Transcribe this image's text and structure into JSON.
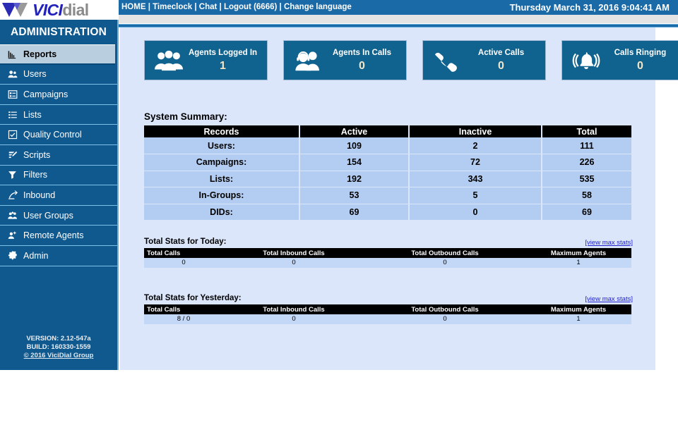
{
  "header": {
    "logo_vici": "VICI",
    "logo_dial": "dial",
    "nav": [
      {
        "label": "HOME"
      },
      {
        "label": "Timeclock"
      },
      {
        "label": "Chat"
      },
      {
        "label": "Logout (6666)"
      },
      {
        "label": "Change language"
      }
    ],
    "separator": " | ",
    "clock": "Thursday March 31, 2016 9:04:41 AM"
  },
  "sidebar": {
    "title": "ADMINISTRATION",
    "items": [
      {
        "label": "Reports",
        "icon": "bar-chart-icon",
        "active": true
      },
      {
        "label": "Users",
        "icon": "users-icon",
        "active": false
      },
      {
        "label": "Campaigns",
        "icon": "list-card-icon",
        "active": false
      },
      {
        "label": "Lists",
        "icon": "list-icon",
        "active": false
      },
      {
        "label": "Quality Control",
        "icon": "checkbox-icon",
        "active": false
      },
      {
        "label": "Scripts",
        "icon": "pencil-doc-icon",
        "active": false
      },
      {
        "label": "Filters",
        "icon": "funnel-icon",
        "active": false
      },
      {
        "label": "Inbound",
        "icon": "arrow-in-icon",
        "active": false
      },
      {
        "label": "User Groups",
        "icon": "user-group-icon",
        "active": false
      },
      {
        "label": "Remote Agents",
        "icon": "user-plus-icon",
        "active": false
      },
      {
        "label": "Admin",
        "icon": "gear-icon",
        "active": false
      }
    ],
    "version": "VERSION: 2.12-547a",
    "build": "BUILD: 160330-1559",
    "copyright": "© 2016 ViciDial Group"
  },
  "cards": [
    {
      "label": "Agents Logged In",
      "value": "1",
      "icon": "three-people-icon"
    },
    {
      "label": "Agents In Calls",
      "value": "0",
      "icon": "headset-agents-icon"
    },
    {
      "label": "Active Calls",
      "value": "0",
      "icon": "phone-handset-icon"
    },
    {
      "label": "Calls Ringing",
      "value": "0",
      "icon": "ringing-bell-icon"
    }
  ],
  "system_summary": {
    "title": "System Summary:",
    "columns": [
      "Records",
      "Active",
      "Inactive",
      "Total"
    ],
    "rows": [
      {
        "label": "Users:",
        "active": "109",
        "inactive": "2",
        "total": "111"
      },
      {
        "label": "Campaigns:",
        "active": "154",
        "inactive": "72",
        "total": "226"
      },
      {
        "label": "Lists:",
        "active": "192",
        "inactive": "343",
        "total": "535"
      },
      {
        "label": "In-Groups:",
        "active": "53",
        "inactive": "5",
        "total": "58"
      },
      {
        "label": "DIDs:",
        "active": "69",
        "inactive": "0",
        "total": "69"
      }
    ]
  },
  "today_stats": {
    "title": "Total Stats for Today:",
    "max_stats_link": "[view max stats]",
    "columns": [
      "Total Calls",
      "Total Inbound Calls",
      "Total Outbound Calls",
      "Maximum Agents"
    ],
    "values": [
      "0",
      "0",
      "0",
      "1"
    ]
  },
  "yesterday_stats": {
    "title": "Total Stats for Yesterday:",
    "max_stats_link": "[view max stats]",
    "columns": [
      "Total Calls",
      "Total Inbound Calls",
      "Total Outbound Calls",
      "Maximum Agents"
    ],
    "values": [
      "8 / 0",
      "0",
      "0",
      "1"
    ]
  },
  "colors": {
    "header_blue": "#1a6aa8",
    "sidebar_blue": "#10598f",
    "content_blue": "#dbe6fb",
    "card_blue": "#10628f",
    "table_row": "#b3cdf2",
    "link_purple": "#5b2d8e",
    "link_blue": "#2222cc"
  }
}
